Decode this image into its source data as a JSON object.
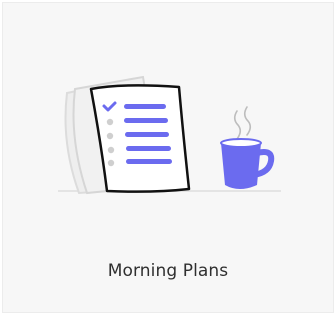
{
  "card": {
    "title": "Morning Plans",
    "icon": "checklist-and-coffee-illustration"
  },
  "colors": {
    "accent": "#6b6bef",
    "outline": "#111111",
    "background": "#f7f7f7",
    "steam": "#bdbdbd"
  },
  "checklist": {
    "items": [
      {
        "checked": true
      },
      {
        "checked": false
      },
      {
        "checked": false
      },
      {
        "checked": false
      },
      {
        "checked": false
      }
    ]
  }
}
